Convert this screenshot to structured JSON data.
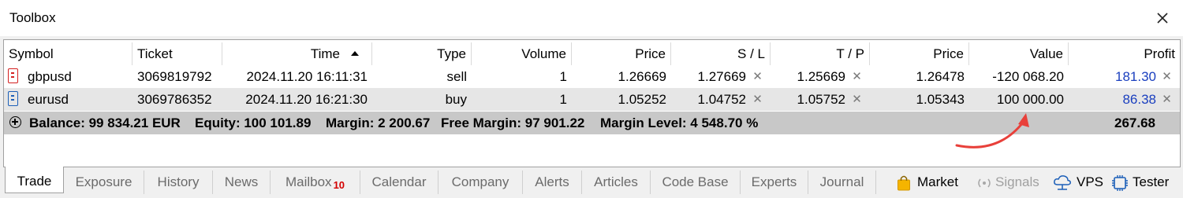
{
  "window": {
    "title": "Toolbox",
    "close_icon": "close-icon"
  },
  "table": {
    "columns": [
      {
        "key": "symbol",
        "label": "Symbol"
      },
      {
        "key": "ticket",
        "label": "Ticket"
      },
      {
        "key": "time",
        "label": "Time",
        "sorted": "ascending"
      },
      {
        "key": "type",
        "label": "Type"
      },
      {
        "key": "volume",
        "label": "Volume"
      },
      {
        "key": "price",
        "label": "Price"
      },
      {
        "key": "sl",
        "label": "S / L"
      },
      {
        "key": "tp",
        "label": "T / P"
      },
      {
        "key": "price2",
        "label": "Price"
      },
      {
        "key": "value",
        "label": "Value"
      },
      {
        "key": "profit",
        "label": "Profit"
      }
    ],
    "rows": [
      {
        "symbol": "gbpusd",
        "ticket": "3069819792",
        "time": "2024.11.20 16:11:31",
        "type": "sell",
        "volume": "1",
        "price": "1.26669",
        "sl": "1.27669",
        "tp": "1.25669",
        "price2": "1.26478",
        "value": "-120 068.20",
        "profit": "181.30",
        "icon": "sell-order-icon",
        "icon_color": "#d42020"
      },
      {
        "symbol": "eurusd",
        "ticket": "3069786352",
        "time": "2024.11.20 16:21:30",
        "type": "buy",
        "volume": "1",
        "price": "1.05252",
        "sl": "1.04752",
        "tp": "1.05752",
        "price2": "1.05343",
        "value": "100 000.00",
        "profit": "86.38",
        "icon": "buy-order-icon",
        "icon_color": "#1c5fb8"
      }
    ],
    "summary": {
      "balance": "Balance: 99 834.21 EUR",
      "equity": "Equity: 100 101.89",
      "margin": "Margin: 2 200.67",
      "free_margin": "Free Margin: 97 901.22",
      "margin_level": "Margin Level: 4 548.70 %",
      "profit": "267.68"
    }
  },
  "tabs": [
    {
      "label": "Trade",
      "active": true
    },
    {
      "label": "Exposure"
    },
    {
      "label": "History"
    },
    {
      "label": "News"
    },
    {
      "label": "Mailbox",
      "badge": "10"
    },
    {
      "label": "Calendar"
    },
    {
      "label": "Company"
    },
    {
      "label": "Alerts"
    },
    {
      "label": "Articles"
    },
    {
      "label": "Code Base"
    },
    {
      "label": "Experts"
    },
    {
      "label": "Journal"
    }
  ],
  "right_buttons": [
    {
      "label": "Market",
      "icon": "shopping-bag-icon"
    },
    {
      "label": "Signals",
      "icon": "signal-icon",
      "disabled": true
    },
    {
      "label": "VPS",
      "icon": "cloud-icon"
    },
    {
      "label": "Tester",
      "icon": "cpu-icon"
    }
  ],
  "colors": {
    "profit": "#1a3fbf",
    "badge": "#d40000",
    "arrow": "#e8403a",
    "summary_bg": "#c8c8c8"
  }
}
